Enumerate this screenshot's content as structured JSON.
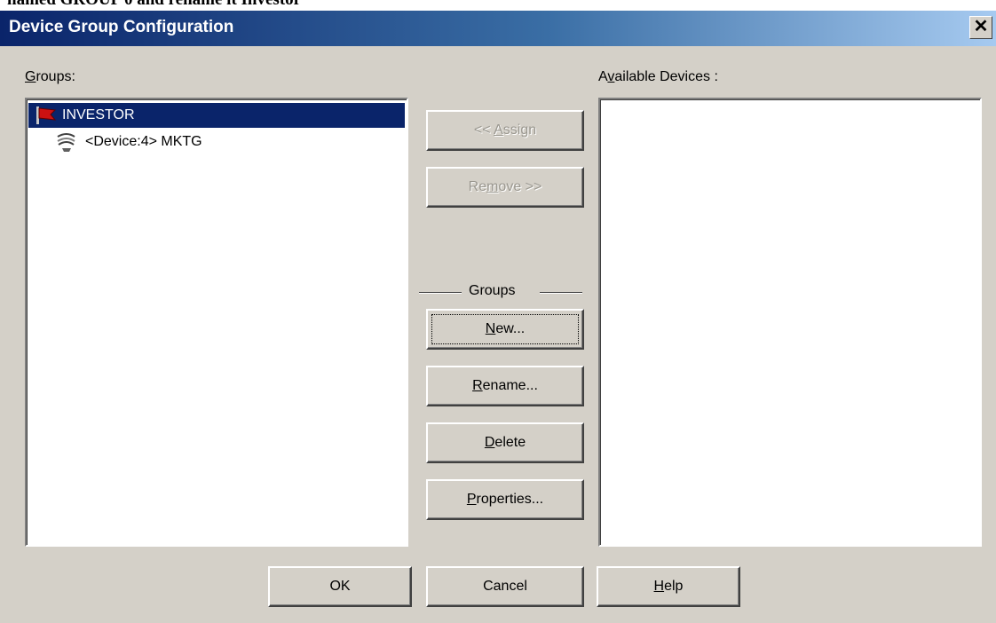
{
  "caption_fragment": "named GROUP 0 and rename it Investor",
  "window": {
    "title": "Device Group Configuration",
    "close_symbol": "✕"
  },
  "groups_panel": {
    "label_hotkey": "G",
    "label_rest": "roups:",
    "tree": [
      {
        "icon": "red-flag-icon",
        "text": "INVESTOR",
        "selected": true
      },
      {
        "icon": "device-icon",
        "text": "<Device:4> MKTG",
        "selected": false
      }
    ]
  },
  "available_panel": {
    "label_pre": "A",
    "label_hotkey": "v",
    "label_rest": "ailable Devices :",
    "items": []
  },
  "assign_button": {
    "pre": "<< ",
    "hotkey": "A",
    "rest": "ssign",
    "enabled": false
  },
  "remove_button": {
    "pre": "Re",
    "hotkey": "m",
    "rest": "ove >>",
    "enabled": false
  },
  "groups_section_label": "Groups",
  "new_button": {
    "hotkey": "N",
    "rest": "ew...",
    "focused": true
  },
  "rename_button": {
    "hotkey": "R",
    "rest": "ename..."
  },
  "delete_button": {
    "hotkey": "D",
    "rest": "elete"
  },
  "properties_button": {
    "hotkey": "P",
    "rest": "roperties..."
  },
  "ok_button": {
    "label": "OK"
  },
  "cancel_button": {
    "label": "Cancel"
  },
  "help_button": {
    "hotkey": "H",
    "rest": "elp"
  },
  "colors": {
    "dialog_face": "#d4d0c8",
    "title_start": "#0a246a",
    "title_end": "#a6caf0",
    "selection": "#0a246a",
    "flag": "#cc1111"
  }
}
